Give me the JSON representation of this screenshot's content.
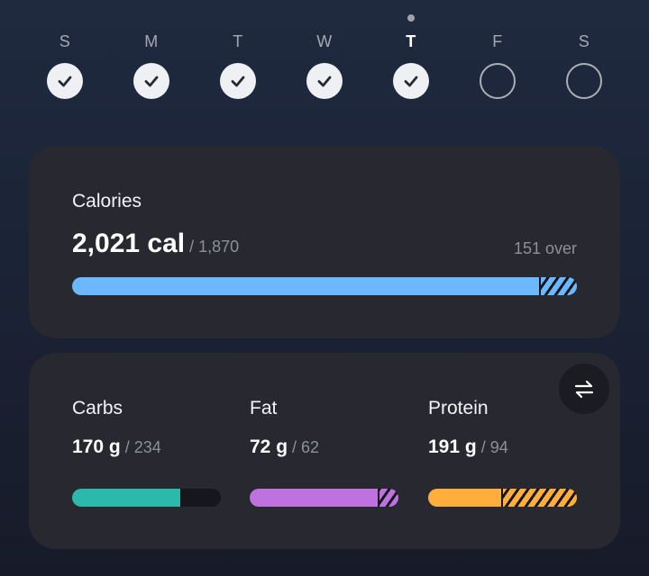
{
  "week": {
    "days": [
      {
        "letter": "S",
        "status": "done"
      },
      {
        "letter": "M",
        "status": "done"
      },
      {
        "letter": "T",
        "status": "done"
      },
      {
        "letter": "W",
        "status": "done"
      },
      {
        "letter": "T",
        "status": "done",
        "today": true
      },
      {
        "letter": "F",
        "status": "empty"
      },
      {
        "letter": "S",
        "status": "empty"
      }
    ],
    "icons": {
      "done": "checkmark-icon",
      "today_marker": "today-dot"
    }
  },
  "calories": {
    "title": "Calories",
    "amount": "2,021 cal",
    "goal": " / 1,870",
    "over_text": "151 over",
    "consumed": 2021,
    "target": 1870,
    "color": "#6cb8ff",
    "over_color": "#6cb8ff"
  },
  "macros": {
    "swap_icon": "swap-arrows-icon",
    "items": [
      {
        "name": "Carbs",
        "amount": "170 g",
        "goal": " / 234",
        "consumed": 170,
        "target": 234,
        "color": "#2bb9ab"
      },
      {
        "name": "Fat",
        "amount": "72 g",
        "goal": " / 62",
        "consumed": 72,
        "target": 62,
        "color": "#c071e0"
      },
      {
        "name": "Protein",
        "amount": "191 g",
        "goal": " / 94",
        "consumed": 191,
        "target": 94,
        "color": "#ffae3c"
      }
    ]
  },
  "colors": {
    "background": "#1b2336",
    "card": "#272830",
    "bar_track": "#16171d",
    "muted_text": "#8d919b"
  }
}
